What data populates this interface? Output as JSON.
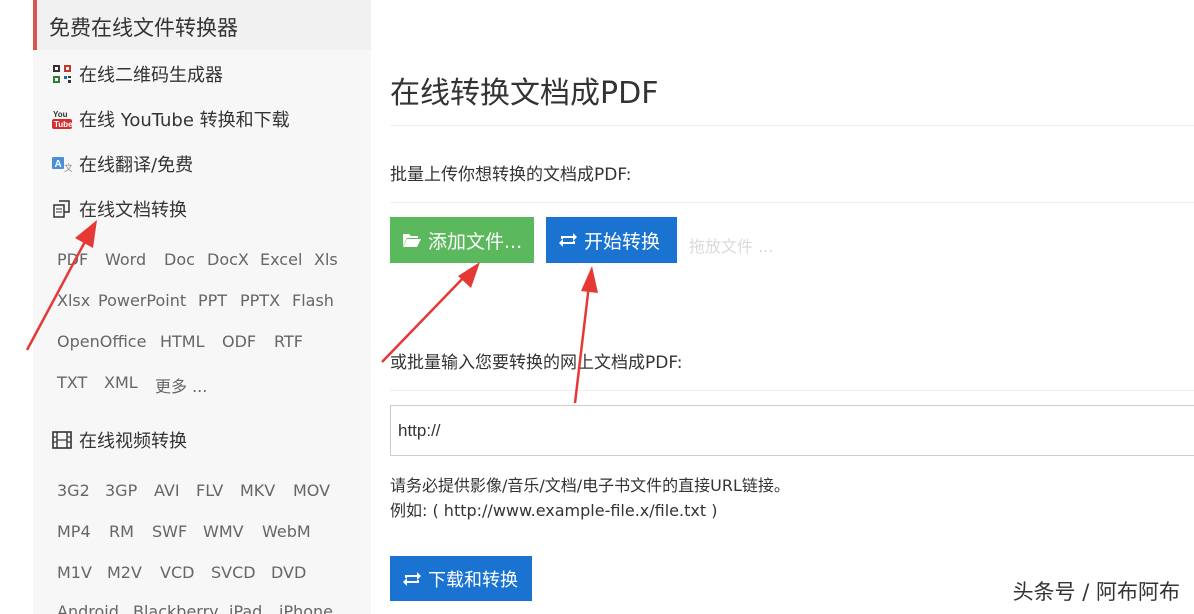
{
  "sidebar": {
    "header": "免费在线文件转换器",
    "menu": [
      {
        "icon": "qr-code-icon",
        "label": "在线二维码生成器"
      },
      {
        "icon": "youtube-icon",
        "label": "在线 YouTube 转换和下载"
      },
      {
        "icon": "translate-icon",
        "label": "在线翻译/免费"
      },
      {
        "icon": "document-copy-icon",
        "label": "在线文档转换"
      },
      {
        "icon": "film-icon",
        "label": "在线视频转换"
      }
    ],
    "doc_formats": [
      [
        "PDF",
        "Word",
        "Doc",
        "DocX",
        "Excel",
        "Xls"
      ],
      [
        "Xlsx",
        "PowerPoint",
        "PPT",
        "PPTX",
        "Flash"
      ],
      [
        "OpenOffice",
        "HTML",
        "ODF",
        "RTF"
      ],
      [
        "TXT",
        "XML",
        "更多 ..."
      ]
    ],
    "video_formats": [
      [
        "3G2",
        "3GP",
        "AVI",
        "FLV",
        "MKV",
        "MOV"
      ],
      [
        "MP4",
        "RM",
        "SWF",
        "WMV",
        "WebM"
      ],
      [
        "M1V",
        "M2V",
        "VCD",
        "SVCD",
        "DVD"
      ],
      [
        "Android",
        "Blackberry",
        "iPad",
        "iPhone"
      ]
    ]
  },
  "main": {
    "title": "在线转换文档成PDF",
    "batch_upload_label": "批量上传你想转换的文档成PDF:",
    "add_files_button": "添加文件...",
    "start_convert_button": "开始转换",
    "drop_files_hint": "拖放文件 ...",
    "url_label": "或批量输入您要转换的网上文档成PDF:",
    "url_input_value": "http://",
    "help_line1": "请务必提供影像/音乐/文档/电子书文件的直接URL链接。",
    "help_line2": "例如: ( http://www.example-file.x/file.txt )",
    "download_convert_button": "下载和转换"
  },
  "watermark": "头条号 / 阿布阿布",
  "colors": {
    "accent_red": "#d9534f",
    "green_button": "#5cb85c",
    "blue_button": "#1a73d0",
    "arrow_red": "#e53935"
  }
}
